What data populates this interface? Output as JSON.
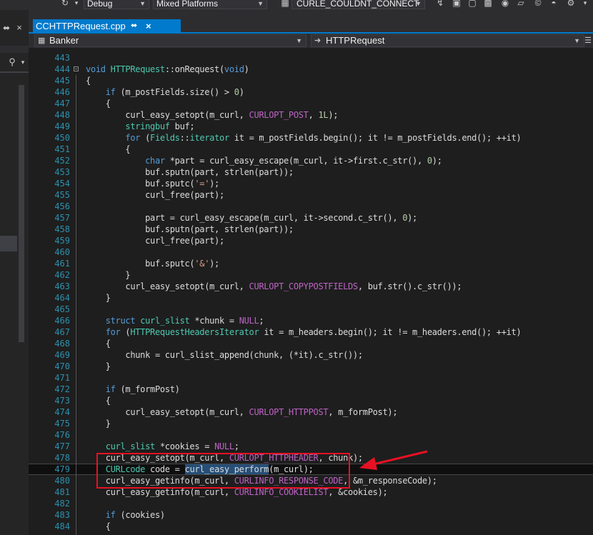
{
  "toolbar": {
    "config": "Debug",
    "platform": "Mixed Platforms",
    "search_symbol": "CURLE_COULDNT_CONNECT"
  },
  "tab": {
    "filename": "CCHTTPRequest.cpp"
  },
  "navbar": {
    "project": "Banker",
    "scope": "HTTPRequest"
  },
  "lines": [
    {
      "n": "443",
      "html": ""
    },
    {
      "n": "444",
      "html": "<span class=\"kw\">void</span> <span class=\"ty\">HTTPRequest</span>::onRequest(<span class=\"kw\">void</span>)"
    },
    {
      "n": "445",
      "html": "{"
    },
    {
      "n": "446",
      "html": "    <span class=\"kw\">if</span> (m_postFields.size() &gt; <span class=\"nm\">0</span>)"
    },
    {
      "n": "447",
      "html": "    {"
    },
    {
      "n": "448",
      "html": "        curl_easy_setopt(m_curl, <span class=\"mc\">CURLOPT_POST</span>, <span class=\"nm\">1L</span>);"
    },
    {
      "n": "449",
      "html": "        <span class=\"ty\">stringbuf</span> buf;"
    },
    {
      "n": "450",
      "html": "        <span class=\"kw\">for</span> (<span class=\"ty\">Fields</span>::<span class=\"ty\">iterator</span> it = m_postFields.begin(); it != m_postFields.end(); ++it)"
    },
    {
      "n": "451",
      "html": "        {"
    },
    {
      "n": "452",
      "html": "            <span class=\"kw\">char</span> *part = curl_easy_escape(m_curl, it-&gt;first.c_str(), <span class=\"nm\">0</span>);"
    },
    {
      "n": "453",
      "html": "            buf.sputn(part, strlen(part));"
    },
    {
      "n": "454",
      "html": "            buf.sputc(<span class=\"st\">'='</span>);"
    },
    {
      "n": "455",
      "html": "            curl_free(part);"
    },
    {
      "n": "456",
      "html": ""
    },
    {
      "n": "457",
      "html": "            part = curl_easy_escape(m_curl, it-&gt;second.c_str(), <span class=\"nm\">0</span>);"
    },
    {
      "n": "458",
      "html": "            buf.sputn(part, strlen(part));"
    },
    {
      "n": "459",
      "html": "            curl_free(part);"
    },
    {
      "n": "460",
      "html": ""
    },
    {
      "n": "461",
      "html": "            buf.sputc(<span class=\"st\">'&amp;'</span>);"
    },
    {
      "n": "462",
      "html": "        }"
    },
    {
      "n": "463",
      "html": "        curl_easy_setopt(m_curl, <span class=\"mc\">CURLOPT_COPYPOSTFIELDS</span>, buf.str().c_str());"
    },
    {
      "n": "464",
      "html": "    }"
    },
    {
      "n": "465",
      "html": ""
    },
    {
      "n": "466",
      "html": "    <span class=\"kw\">struct</span> <span class=\"ty\">curl_slist</span> *chunk = <span class=\"mc\">NULL</span>;"
    },
    {
      "n": "467",
      "html": "    <span class=\"kw\">for</span> (<span class=\"ty\">HTTPRequestHeadersIterator</span> it = m_headers.begin(); it != m_headers.end(); ++it)"
    },
    {
      "n": "468",
      "html": "    {"
    },
    {
      "n": "469",
      "html": "        chunk = curl_slist_append(chunk, (*it).c_str());"
    },
    {
      "n": "470",
      "html": "    }"
    },
    {
      "n": "471",
      "html": ""
    },
    {
      "n": "472",
      "html": "    <span class=\"kw\">if</span> (m_formPost)"
    },
    {
      "n": "473",
      "html": "    {"
    },
    {
      "n": "474",
      "html": "        curl_easy_setopt(m_curl, <span class=\"mc\">CURLOPT_HTTPPOST</span>, m_formPost);"
    },
    {
      "n": "475",
      "html": "    }"
    },
    {
      "n": "476",
      "html": ""
    },
    {
      "n": "477",
      "html": "    <span class=\"ty\">curl_slist</span> *cookies = <span class=\"mc\">NULL</span>;"
    },
    {
      "n": "478",
      "html": "    curl_easy_setopt(m_curl, <span class=\"mc\">CURLOPT_HTTPHEADER</span>, chunk);"
    },
    {
      "n": "479",
      "html": "    <span class=\"ty\">CURLcode</span> code = <span class=\"hl\">curl_easy_perform</span>(m_curl);"
    },
    {
      "n": "480",
      "html": "    curl_easy_getinfo(m_curl, <span class=\"mc\">CURLINFO_RESPONSE_CODE</span>, &amp;m_responseCode);"
    },
    {
      "n": "481",
      "html": "    curl_easy_getinfo(m_curl, <span class=\"mc\">CURLINFO_COOKIELIST</span>, &amp;cookies);"
    },
    {
      "n": "482",
      "html": ""
    },
    {
      "n": "483",
      "html": "    <span class=\"kw\">if</span> (cookies)"
    },
    {
      "n": "484",
      "html": "    {"
    }
  ],
  "current_line": "479",
  "colors": {
    "accent": "#007acc",
    "annotation": "#e81123",
    "line_number": "#2b91af",
    "keyword": "#569cd6",
    "type": "#4ec9b0",
    "macro": "#bd63c5",
    "number": "#b5cea8",
    "string": "#d69d85"
  }
}
